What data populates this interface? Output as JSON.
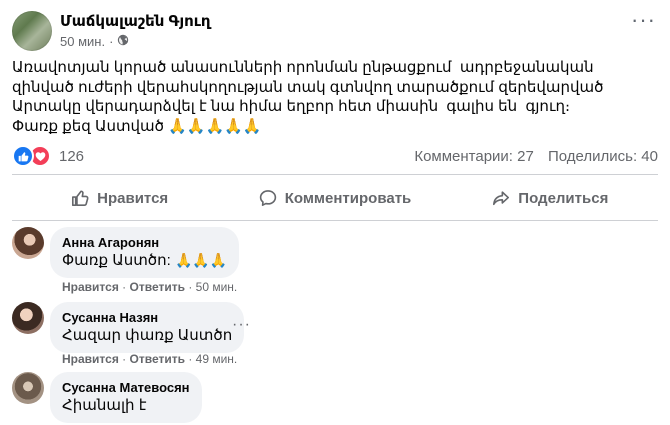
{
  "post": {
    "page_name": "Մաճկալաշեն Գյուղ",
    "time": "50 мин.",
    "separator": "·",
    "audience_icon": "globe-icon",
    "more_icon": "ellipsis-icon",
    "more_glyph": "···",
    "text": "Առավոտյան կորած անասունների որոնման ընթացքում  ադրբեջանական զինված ուժերի վերահսկողության տակ գտնվող տարածքում զերեվարված Արտակը վերադարձվել է նա հիմա եղբոր հետ միասին  գալիս են  գյուղ։\nՓառք քեզ Աստված 🙏🙏🙏🙏🙏"
  },
  "stats": {
    "reactions_count": "126",
    "reaction_icons": [
      "like-icon",
      "love-icon"
    ],
    "comments": "Комментарии: 27",
    "shares": "Поделились: 40"
  },
  "actions": {
    "like_label": "Нравится",
    "comment_label": "Комментировать",
    "share_label": "Поделиться"
  },
  "comments": [
    {
      "author": "Анна Агаронян",
      "text": "Փառք Աստծո:",
      "emoji": "🙏🙏🙏",
      "like": "Нравится",
      "reply": "Ответить",
      "time": "50 мин."
    },
    {
      "author": "Сусанна Назян",
      "text": "Հազար փառք Աստծո",
      "like": "Нравится",
      "reply": "Ответить",
      "time": "49 мин."
    },
    {
      "author": "Сусанна Матевосян",
      "text": "Հիանալի է"
    }
  ],
  "dot": "·",
  "comment_more_glyph": "···",
  "colors": {
    "like_blue": "#1877f2",
    "love_red": "#f33e58",
    "secondary_text": "#65676b",
    "bubble_bg": "#f0f2f5"
  }
}
